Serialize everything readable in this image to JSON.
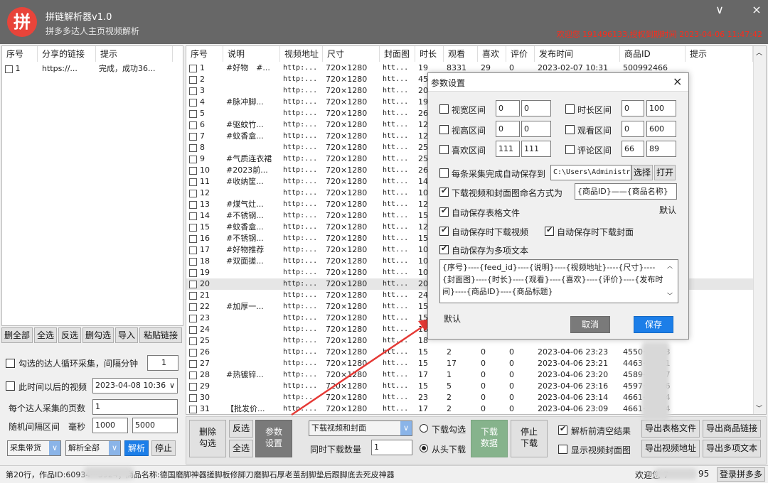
{
  "app": {
    "logo": "拼",
    "title": "拼链解析器v1.0",
    "subtitle": "拼多多达人主页视频解析",
    "min_icon": "∨",
    "close_icon": "×",
    "welcome": "欢迎您 191496133,授权到期时间 2023-04-06 11:47:42"
  },
  "left": {
    "headers": [
      "序号",
      "分享的链接",
      "提示"
    ],
    "rows": [
      {
        "idx": "1",
        "link": "https://...",
        "tip": "完成，成功36..."
      }
    ],
    "actions": [
      "删全部",
      "全选",
      "反选",
      "删勾选",
      "导入",
      "粘贴链接"
    ],
    "loop_label": "勾选的达人循环采集，间隔分钟",
    "loop_value": "1",
    "after_label": "此时间以后的视频",
    "after_value": "2023-04-08 10:36",
    "pages_label": "每个达人采集的页数",
    "pages_value": "1",
    "interval_label": "随机间隔区间",
    "ms_label": "毫秒",
    "interval_min": "1000",
    "interval_max": "5000",
    "mode_select": "采集带货",
    "parse_select": "解析全部",
    "parse_btn": "解析",
    "stop_btn": "停止"
  },
  "grid": {
    "headers": [
      "序号",
      "说明",
      "视频地址",
      "尺寸",
      "封面图",
      "时长",
      "观看",
      "喜欢",
      "评价",
      "发布时间",
      "商品ID",
      "提示"
    ],
    "rows": [
      [
        "1",
        "#好物　#...",
        "http:...",
        "720×1280",
        "htt...",
        "19",
        "8331",
        "29",
        "0",
        "2023-02-07 10:31",
        "500992466"
      ],
      [
        "2",
        "",
        "http:...",
        "720×1280",
        "htt...",
        "45",
        "",
        "",
        "",
        "",
        ""
      ],
      [
        "3",
        "",
        "http:...",
        "720×1280",
        "htt...",
        "20",
        "",
        "",
        "",
        "",
        ""
      ],
      [
        "4",
        "#脉冲脚...",
        "http:...",
        "720×1280",
        "htt...",
        "19",
        "",
        "",
        "",
        "",
        ""
      ],
      [
        "5",
        "",
        "http:...",
        "720×1280",
        "htt...",
        "26",
        "",
        "",
        "",
        "",
        ""
      ],
      [
        "6",
        "#驱蚊竹...",
        "http:...",
        "720×1280",
        "htt...",
        "12",
        "",
        "",
        "",
        "",
        ""
      ],
      [
        "7",
        "#蚊香盒...",
        "http:...",
        "720×1280",
        "htt...",
        "12",
        "",
        "",
        "",
        "",
        ""
      ],
      [
        "8",
        "",
        "http:...",
        "720×1280",
        "htt...",
        "25",
        "",
        "",
        "",
        "",
        ""
      ],
      [
        "9",
        "#气质连衣裙",
        "http:...",
        "720×1280",
        "htt...",
        "25",
        "",
        "",
        "",
        "",
        ""
      ],
      [
        "10",
        "#2023前...",
        "http:...",
        "720×1280",
        "htt...",
        "26",
        "",
        "",
        "",
        "",
        ""
      ],
      [
        "11",
        "#收纳筐...",
        "http:...",
        "720×1280",
        "htt...",
        "14",
        "",
        "",
        "",
        "",
        ""
      ],
      [
        "12",
        "",
        "http:...",
        "720×1280",
        "htt...",
        "10",
        "",
        "",
        "",
        "",
        ""
      ],
      [
        "13",
        "#煤气灶...",
        "http:...",
        "720×1280",
        "htt...",
        "12",
        "",
        "",
        "",
        "",
        ""
      ],
      [
        "14",
        "#不锈钢...",
        "http:...",
        "720×1280",
        "htt...",
        "15",
        "",
        "",
        "",
        "",
        ""
      ],
      [
        "15",
        "#蚊香盒...",
        "http:...",
        "720×1280",
        "htt...",
        "12",
        "",
        "",
        "",
        "",
        ""
      ],
      [
        "16",
        "#不锈钢...",
        "http:...",
        "720×1280",
        "htt...",
        "15",
        "",
        "",
        "",
        "",
        ""
      ],
      [
        "17",
        "#好物推荐",
        "http:...",
        "720×1280",
        "htt...",
        "10",
        "",
        "",
        "",
        "",
        ""
      ],
      [
        "18",
        "#双面搓...",
        "http:...",
        "720×1280",
        "htt...",
        "10",
        "",
        "",
        "",
        "",
        ""
      ],
      [
        "19",
        "",
        "http:...",
        "720×1280",
        "htt...",
        "10",
        "",
        "",
        "",
        "",
        ""
      ],
      [
        "20",
        "",
        "http:...",
        "720×1280",
        "htt...",
        "20",
        "",
        "",
        "",
        "",
        ""
      ],
      [
        "21",
        "",
        "http:...",
        "720×1280",
        "htt...",
        "24",
        "",
        "",
        "",
        "",
        ""
      ],
      [
        "22",
        "#加厚一...",
        "http:...",
        "720×1280",
        "htt...",
        "15",
        "",
        "",
        "",
        "",
        ""
      ],
      [
        "23",
        "",
        "http:...",
        "720×1280",
        "htt...",
        "15",
        "",
        "",
        "",
        "",
        ""
      ],
      [
        "24",
        "",
        "http:...",
        "720×1280",
        "htt...",
        "18",
        "",
        "",
        "",
        "",
        ""
      ],
      [
        "25",
        "",
        "http:...",
        "720×1280",
        "htt...",
        "18",
        "",
        "",
        "",
        "",
        ""
      ],
      [
        "26",
        "",
        "http:...",
        "720×1280",
        "htt...",
        "15",
        "2",
        "0",
        "0",
        "2023-04-06 23:23",
        "4550···3033"
      ],
      [
        "27",
        "",
        "http:...",
        "720×1280",
        "htt...",
        "15",
        "17",
        "0",
        "0",
        "2023-04-06 23:21",
        "4463···4091"
      ],
      [
        "28",
        "#热镀锌...",
        "http:...",
        "720×1280",
        "htt...",
        "17",
        "1",
        "0",
        "0",
        "2023-04-06 23:20",
        "4589···1797"
      ],
      [
        "29",
        "",
        "http:...",
        "720×1280",
        "htt...",
        "15",
        "5",
        "0",
        "0",
        "2023-04-06 23:16",
        "4597···8476"
      ],
      [
        "30",
        "",
        "http:...",
        "720×1280",
        "htt...",
        "23",
        "2",
        "0",
        "0",
        "2023-04-06 23:14",
        "4661···5534"
      ],
      [
        "31",
        "【批发价...",
        "http:...",
        "720×1280",
        "htt...",
        "17",
        "2",
        "0",
        "0",
        "2023-04-06 23:09",
        "4661···5534"
      ]
    ]
  },
  "dialog": {
    "title": "参数设置",
    "close": "×",
    "ranges": [
      {
        "label": "视宽区间",
        "min": "0",
        "max": "0"
      },
      {
        "label": "视高区间",
        "min": "0",
        "max": "0"
      },
      {
        "label": "喜欢区间",
        "min": "111",
        "max": "111"
      },
      {
        "label": "时长区间",
        "min": "0",
        "max": "100"
      },
      {
        "label": "观看区间",
        "min": "0",
        "max": "600"
      },
      {
        "label": "评论区间",
        "min": "66",
        "max": "89"
      }
    ],
    "autosave_label": "每条采集完成自动保存到",
    "autosave_path": "C:\\Users\\Administr",
    "choose_btn": "选择",
    "open_btn": "打开",
    "naming_label": "下载视频和封面图命名方式为",
    "naming_value": "{商品ID}——{商品名称}",
    "default_link": "默认",
    "save_table_label": "自动保存表格文件",
    "save_video_label": "自动保存时下载视频",
    "save_cover_label": "自动保存时下载封面",
    "save_text_label": "自动保存为多项文本",
    "template_text": "{序号}----{feed_id}----{说明}----{视频地址}----{尺寸}----{封面图}----{时长}----{观看}----{喜欢}----{评价}----{发布时间}----{商品ID}----{商品标题}",
    "default_btn": "默认",
    "cancel_btn": "取消",
    "save_btn": "保存"
  },
  "bottom": {
    "del_btn": "删除\n勾选",
    "invert_btn": "反选",
    "all_btn": "全选",
    "params_btn": "参数\n设置",
    "download_select": "下载视频和封面",
    "concurrent_label": "同时下载数量",
    "concurrent_value": "1",
    "radio_checked_label": "下载勾选",
    "radio_head_label": "从头下载",
    "download_btn": "下载\n数据",
    "stop_download_btn": "停止\n下载",
    "clear_label": "解析前清空结果",
    "show_cover_label": "显示视频封面图",
    "export_table": "导出表格文件",
    "export_goods": "导出商品链接",
    "export_video": "导出视频地址",
    "export_text": "导出多项文本"
  },
  "status": {
    "left": "第20行，作品ID:60934···3924；商品名称:德国磨脚神器搓脚板修脚刀磨脚石厚老茧刮脚垫后跟脚底去死皮神器",
    "welcome": "欢迎您 7",
    "suffix": "95",
    "login_btn": "登录拼多多"
  },
  "colors": {
    "titlebar": "#676767",
    "logo": "#e8443a",
    "accent": "#1c7ee8",
    "arrow": "#e53935",
    "welcome": "#ff2a1a"
  }
}
